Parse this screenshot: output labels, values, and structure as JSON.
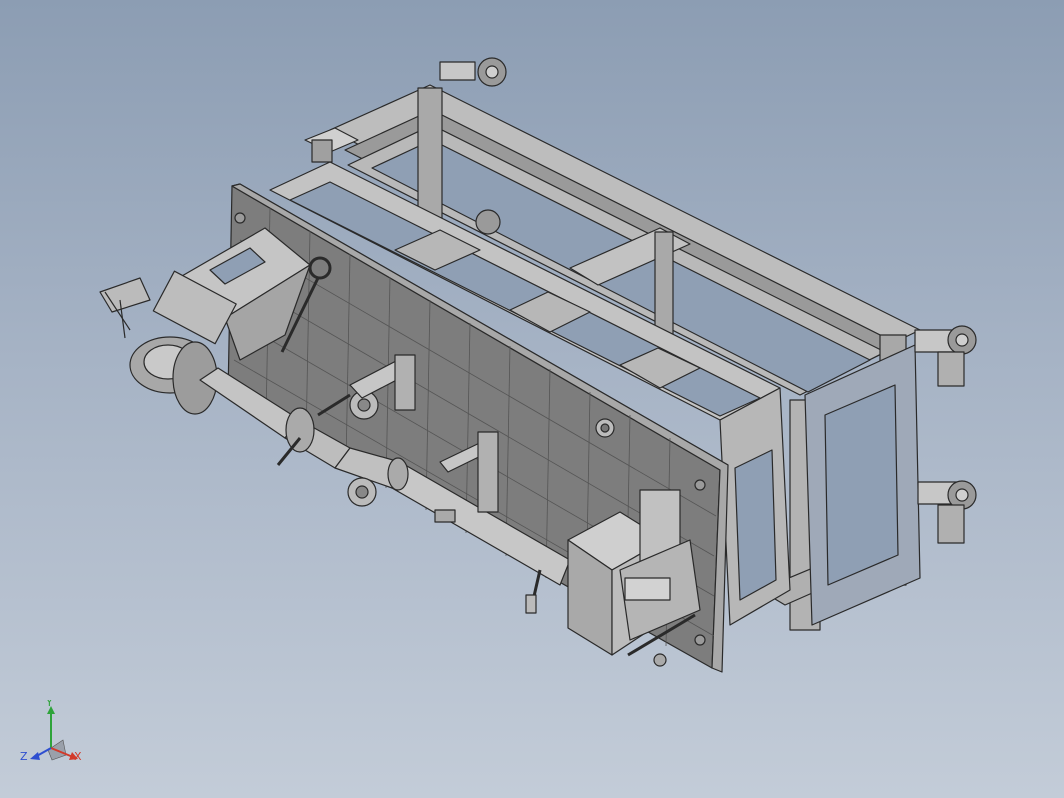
{
  "viewport": {
    "background_top": "#8c9db3",
    "background_bottom": "#c3ccd8"
  },
  "model": {
    "part_color": "#b6b6b6",
    "part_shade": "#8e8e8e",
    "edge_color": "#2a2a2a"
  },
  "triad": {
    "x_label": "X",
    "y_label": "Y",
    "z_label": "Z",
    "x_color": "#d23a2a",
    "y_color": "#2ea33a",
    "z_color": "#2e4fd0"
  }
}
